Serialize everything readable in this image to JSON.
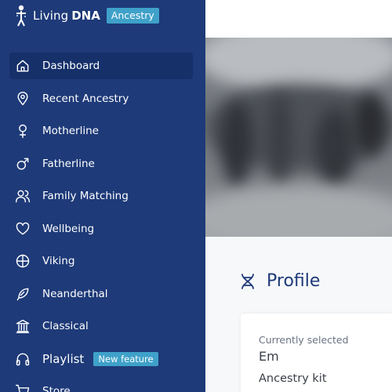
{
  "brand": {
    "living": "Living",
    "dna": "DNA",
    "tag": "Ancestry"
  },
  "nav": {
    "items": [
      {
        "label": "Dashboard",
        "icon": "home-icon",
        "active": true
      },
      {
        "label": "Recent Ancestry",
        "icon": "location-pin-icon"
      },
      {
        "label": "Motherline",
        "icon": "female-symbol-icon"
      },
      {
        "label": "Fatherline",
        "icon": "male-symbol-icon"
      },
      {
        "label": "Family Matching",
        "icon": "users-icon"
      },
      {
        "label": "Wellbeing",
        "icon": "heart-icon"
      },
      {
        "label": "Viking",
        "icon": "viking-shield-icon"
      },
      {
        "label": "Neanderthal",
        "icon": "feather-icon"
      },
      {
        "label": "Classical",
        "icon": "classical-building-icon"
      },
      {
        "label": "Playlist",
        "icon": "headphones-icon",
        "badge": "New feature"
      },
      {
        "label": "Store",
        "icon": "cart-icon"
      }
    ]
  },
  "profile": {
    "title": "Profile",
    "icon": "dna-icon",
    "card": {
      "selected_label": "Currently selected",
      "name": "Em",
      "kit": "Ancestry kit"
    }
  },
  "colors": {
    "sidebar": "#1e3a78",
    "active": "#16306a",
    "accent": "#3fa1c9"
  }
}
